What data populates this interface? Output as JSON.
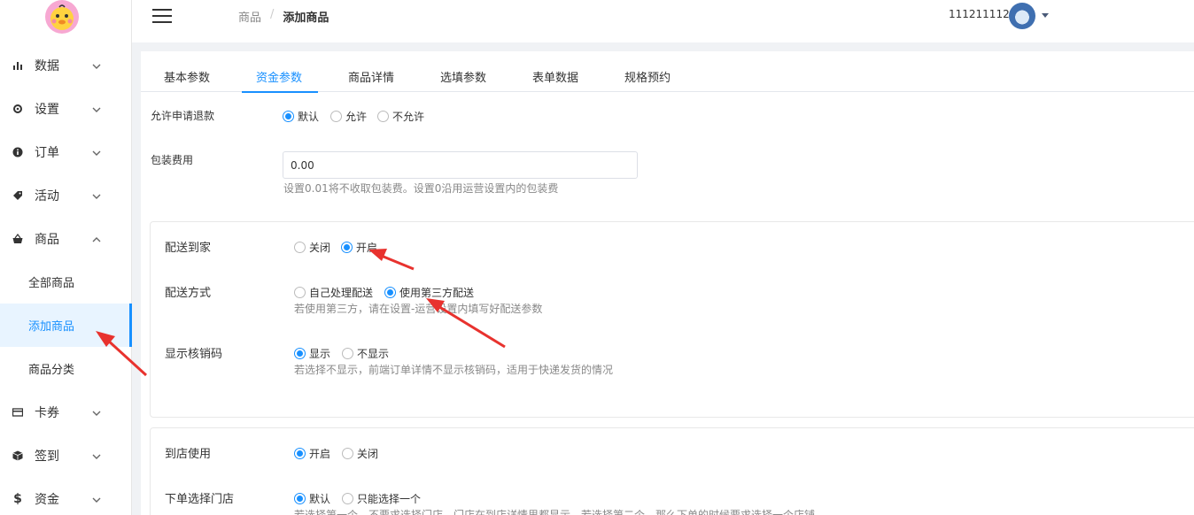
{
  "sidebar": {
    "items": [
      {
        "label": "数据",
        "icon": "bar-chart-icon"
      },
      {
        "label": "设置",
        "icon": "gear-icon"
      },
      {
        "label": "订单",
        "icon": "info-icon"
      },
      {
        "label": "活动",
        "icon": "tag-icon"
      },
      {
        "label": "商品",
        "icon": "basket-icon"
      },
      {
        "label": "卡券",
        "icon": "card-icon"
      },
      {
        "label": "签到",
        "icon": "box-icon"
      },
      {
        "label": "资金",
        "icon": "dollar-icon"
      }
    ],
    "sub_items": [
      {
        "label": "全部商品"
      },
      {
        "label": "添加商品"
      },
      {
        "label": "商品分类"
      }
    ]
  },
  "header": {
    "breadcrumb": {
      "parent": "商品",
      "separator": "/",
      "current": "添加商品"
    },
    "user_id": "1112111122"
  },
  "tabs": [
    "基本参数",
    "资金参数",
    "商品详情",
    "选填参数",
    "表单数据",
    "规格预约"
  ],
  "form": {
    "refund": {
      "label": "允许申请退款",
      "options": [
        "默认",
        "允许",
        "不允许"
      ],
      "selected": "默认"
    },
    "packing": {
      "label": "包装费用",
      "value": "0.00",
      "help": "设置0.01将不收取包装费。设置0沿用运营设置内的包装费"
    },
    "delivery_home": {
      "label": "配送到家",
      "options": [
        "关闭",
        "开启"
      ],
      "selected": "开启"
    },
    "delivery_method": {
      "label": "配送方式",
      "options": [
        "自己处理配送",
        "使用第三方配送"
      ],
      "selected": "使用第三方配送",
      "help": "若使用第三方，请在设置-运营设置内填写好配送参数"
    },
    "show_code": {
      "label": "显示核销码",
      "options": [
        "显示",
        "不显示"
      ],
      "selected": "显示",
      "help": "若选择不显示，前端订单详情不显示核销码，适用于快递发货的情况"
    },
    "in_store": {
      "label": "到店使用",
      "options": [
        "开启",
        "关闭"
      ],
      "selected": "开启"
    },
    "store_select": {
      "label": "下单选择门店",
      "options": [
        "默认",
        "只能选择一个"
      ],
      "selected": "默认",
      "help": "若选择第一个，不要求选择门店，门店在到店详情里都显示，若选择第二个，那么下单的时候要求选择一个店铺"
    }
  },
  "colors": {
    "accent": "#1890ff",
    "arrow": "#e8322e"
  }
}
